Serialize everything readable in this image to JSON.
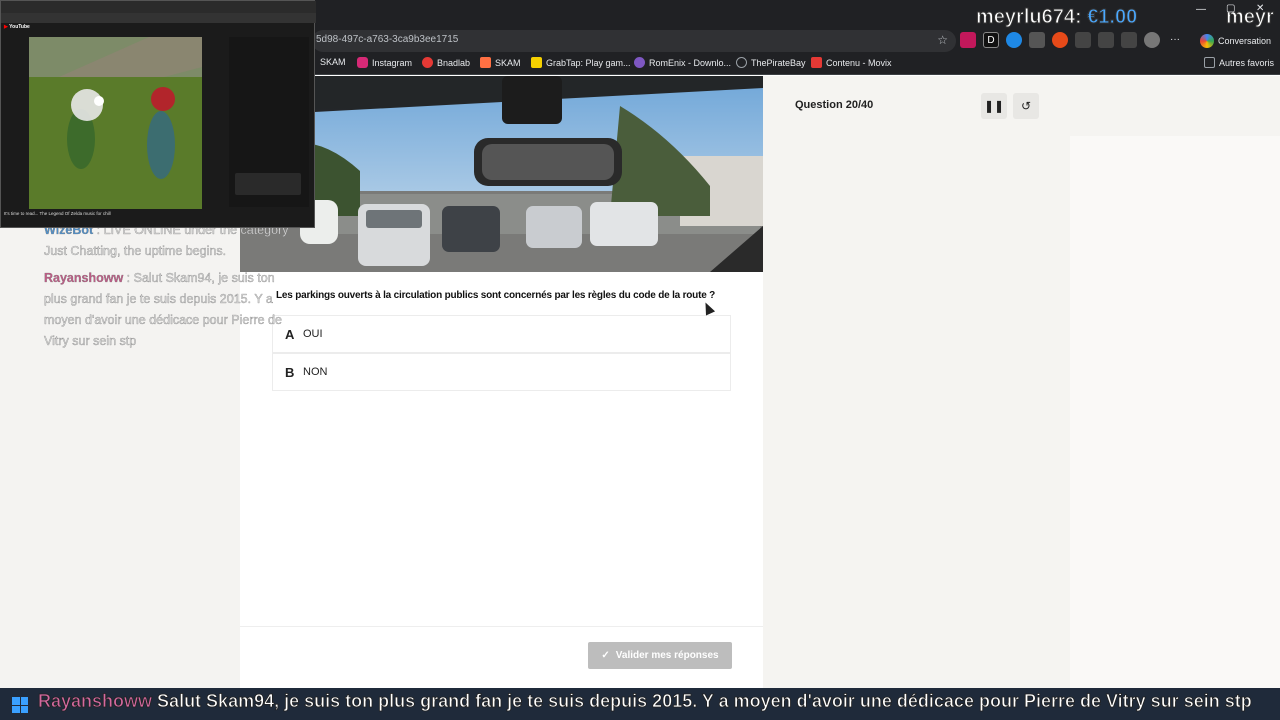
{
  "browser": {
    "url_fragment": "5d98-497c-a763-3ca9b3ee1715",
    "conversation_label": "Conversation",
    "bookmarks": [
      {
        "label": "SKAM",
        "color": "#e8eaed"
      },
      {
        "label": "Instagram",
        "color": "#d62976"
      },
      {
        "label": "Bnadlab",
        "color": "#e53935"
      },
      {
        "label": "SKAM",
        "color": "#ff7043"
      },
      {
        "label": "GrabTap: Play gam...",
        "color": "#f5d000"
      },
      {
        "label": "RomEnix - Downlo...",
        "color": "#7e57c2"
      },
      {
        "label": "ThePirateBay",
        "color": "#9aa0a6"
      },
      {
        "label": "Contenu - Movix",
        "color": "#e53935"
      }
    ],
    "other_bookmarks": "Autres favoris"
  },
  "overlay": {
    "donor": "meyrlu674:",
    "amount": "€1.00",
    "donor_cut": "meyr"
  },
  "quiz": {
    "question_counter": "Question 20/40",
    "question": "Les parkings ouverts à la circulation publics sont concernés par les règles du code de la route ?",
    "answers": [
      {
        "letter": "A",
        "text": "OUI"
      },
      {
        "letter": "B",
        "text": "NON"
      }
    ],
    "submit_label": "Valider mes réponses",
    "pause_icon": "pause-icon",
    "restart_icon": "restart-icon"
  },
  "chat": {
    "bot_name": "WizeBot",
    "bot_message": "LIVE ONLINE under the category Just Chatting, the uptime begins.",
    "user_name": "Rayanshoww",
    "user_message": "Salut Skam94, je suis ton plus grand fan je te suis depuis 2015. Y a moyen d'avoir une dédicace pour Pierre de Vitry sur sein stp"
  },
  "ticker": {
    "user_name": "Rayanshoww",
    "message": "Salut Skam94, je suis ton plus grand fan je te suis depuis 2015. Y a moyen d'avoir une dédicace pour Pierre de Vitry sur sein stp"
  },
  "pip": {
    "site": "YouTube",
    "video_title": "It's time to read... The Legend Of Zelda music for chill"
  },
  "colors": {
    "accent_button": "#bdbdbd",
    "chat_name": "#c05a86",
    "amount": "#4aa8ff"
  }
}
